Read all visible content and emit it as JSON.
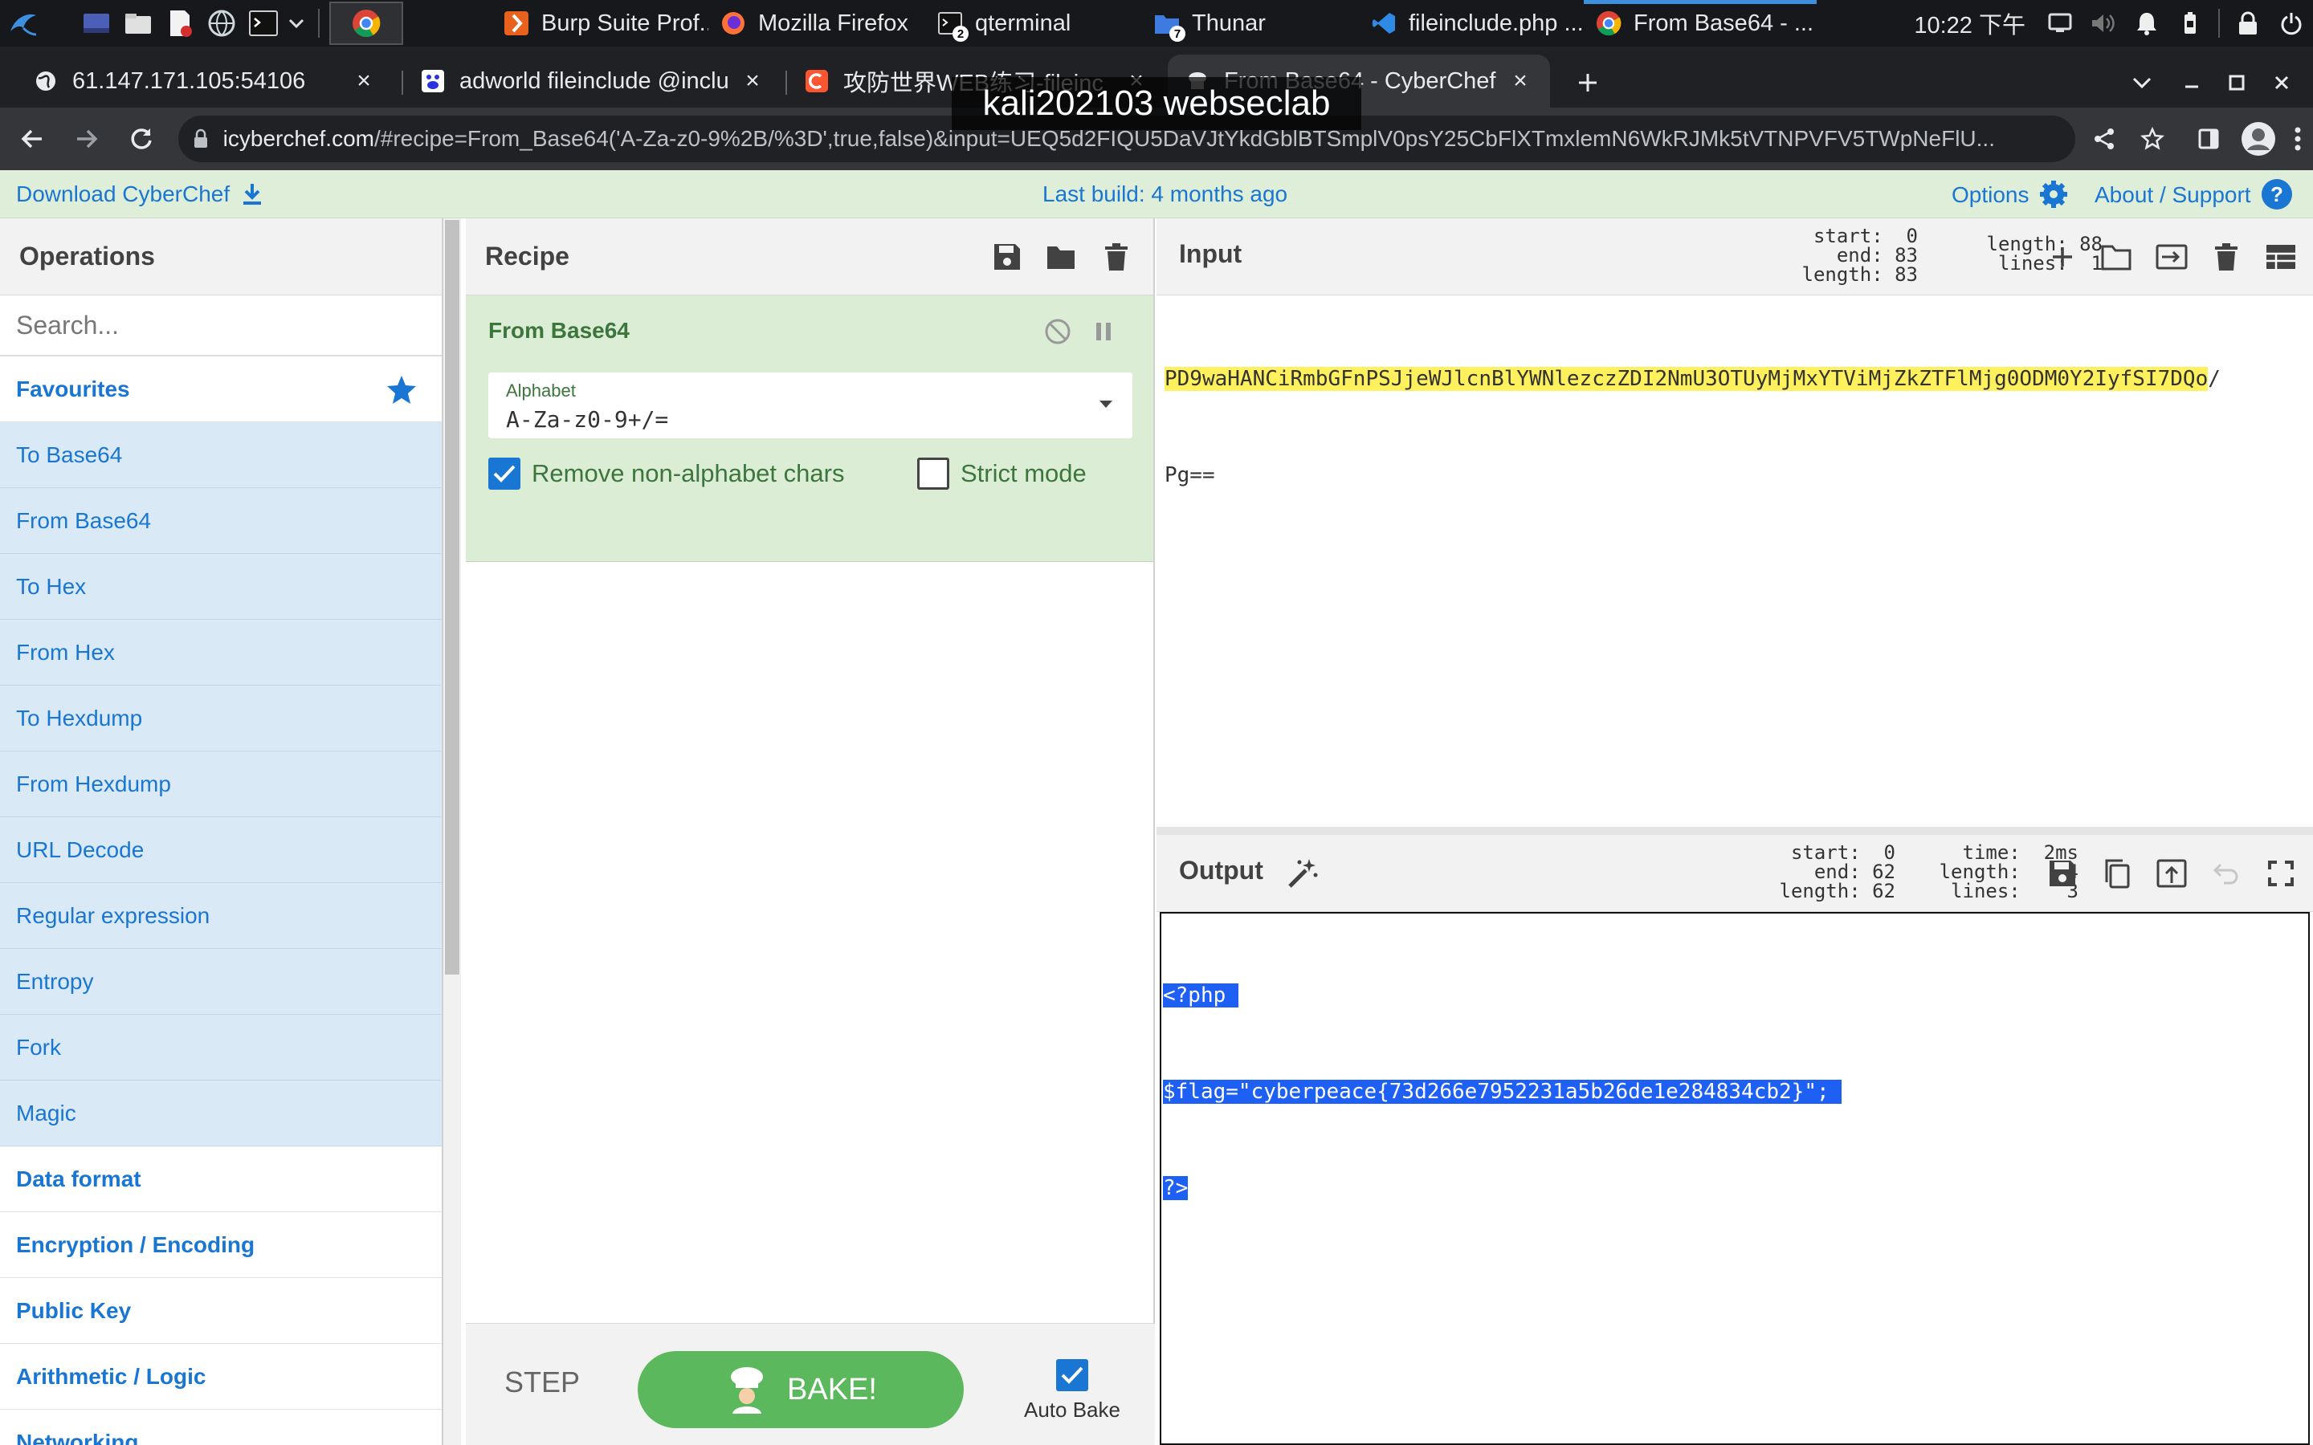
{
  "taskbar": {
    "tasks": [
      {
        "label": "Burp Suite Prof...",
        "icon": "burp-icon"
      },
      {
        "label": "Mozilla Firefox",
        "icon": "firefox-icon"
      },
      {
        "label": "qterminal",
        "icon": "terminal-icon",
        "badge": "2"
      },
      {
        "label": "Thunar",
        "icon": "folder-icon",
        "badge": "7"
      },
      {
        "label": "fileinclude.php ...",
        "icon": "vscode-icon"
      },
      {
        "label": "From Base64 - ...",
        "icon": "chrome-icon"
      }
    ],
    "clock": "10:22 下午"
  },
  "browser": {
    "tabs": [
      {
        "title": "61.147.171.105:54106",
        "icon": "globe-icon"
      },
      {
        "title": "adworld fileinclude @inclu",
        "icon": "baidu-icon"
      },
      {
        "title": "攻防世界WEB练习-fileinc",
        "icon": "csdn-icon"
      },
      {
        "title": "From Base64 - CyberChef",
        "icon": "chef-icon"
      }
    ],
    "url_domain": "icyberchef.com",
    "url_path": "/#recipe=From_Base64('A-Za-z0-9%2B/%3D',true,false)&input=UEQ5d2FIQU5DaVJtYkdGblBTSmplV0psY25CbFlXTmxlemN6WkRJMk5tVTNPVFV5TWpNeFlU..."
  },
  "watermark": "kali202103 webseclab",
  "banner": {
    "download": "Download CyberChef",
    "last_build": "Last build: 4 months ago",
    "options": "Options",
    "about": "About / Support"
  },
  "operations": {
    "title": "Operations",
    "search_placeholder": "Search...",
    "favourites": "Favourites",
    "items": [
      "To Base64",
      "From Base64",
      "To Hex",
      "From Hex",
      "To Hexdump",
      "From Hexdump",
      "URL Decode",
      "Regular expression",
      "Entropy",
      "Fork",
      "Magic"
    ],
    "categories": [
      "Data format",
      "Encryption / Encoding",
      "Public Key",
      "Arithmetic / Logic",
      "Networking"
    ]
  },
  "recipe": {
    "title": "Recipe",
    "op_name": "From Base64",
    "alphabet_label": "Alphabet",
    "alphabet_value": "A-Za-z0-9+/=",
    "remove_label": "Remove non-alphabet chars",
    "strict_label": "Strict mode",
    "step": "STEP",
    "bake": "BAKE!",
    "auto_bake": "Auto Bake"
  },
  "input": {
    "title": "Input",
    "stats_left": "start:  0\n  end: 83\nlength: 83",
    "stats_right": "length: 88\n lines:  1",
    "line1": "PD9waHANCiRmbGFnPSJjeWJlcnBlYWNlezczZDI2NmU3OTUyMjMxYTViMjZkZTFlMjg0ODM0Y2IyfSI7DQo",
    "line1_tail": "/",
    "line2": "Pg=="
  },
  "output": {
    "title": "Output",
    "stats_left": " start:  0\n   end: 62\nlength: 62",
    "stats_right": "  time:  2ms\nlength:   64\n lines:    3",
    "lines": [
      "<?php ",
      "$flag=\"cyberpeace{73d266e7952231a5b26de1e284834cb2}\"; ",
      "?>"
    ]
  },
  "colors": {
    "accent": "#1976d2",
    "bake": "#5cb85c",
    "ingredient_bg": "#dcedd6",
    "highlight": "#fff05e",
    "selection": "#1e5ff4"
  }
}
